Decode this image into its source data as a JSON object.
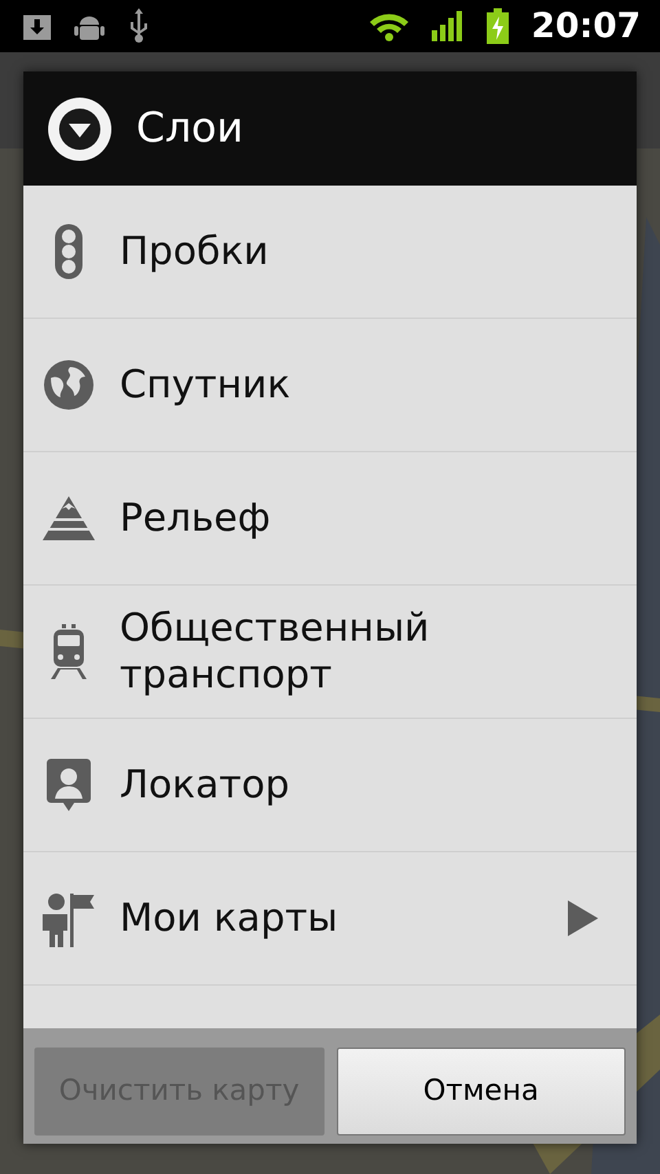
{
  "status_bar": {
    "time": "20:07"
  },
  "dialog": {
    "title": "Слои",
    "items": [
      {
        "label": "Пробки",
        "submenu": false
      },
      {
        "label": "Спутник",
        "submenu": false
      },
      {
        "label": "Рельеф",
        "submenu": false
      },
      {
        "label": "Общественный транспорт",
        "submenu": false
      },
      {
        "label": "Локатор",
        "submenu": false
      },
      {
        "label": "Мои карты",
        "submenu": true
      }
    ],
    "buttons": [
      {
        "label": "Очистить карту",
        "disabled": true
      },
      {
        "label": "Отмена",
        "disabled": false
      }
    ]
  }
}
